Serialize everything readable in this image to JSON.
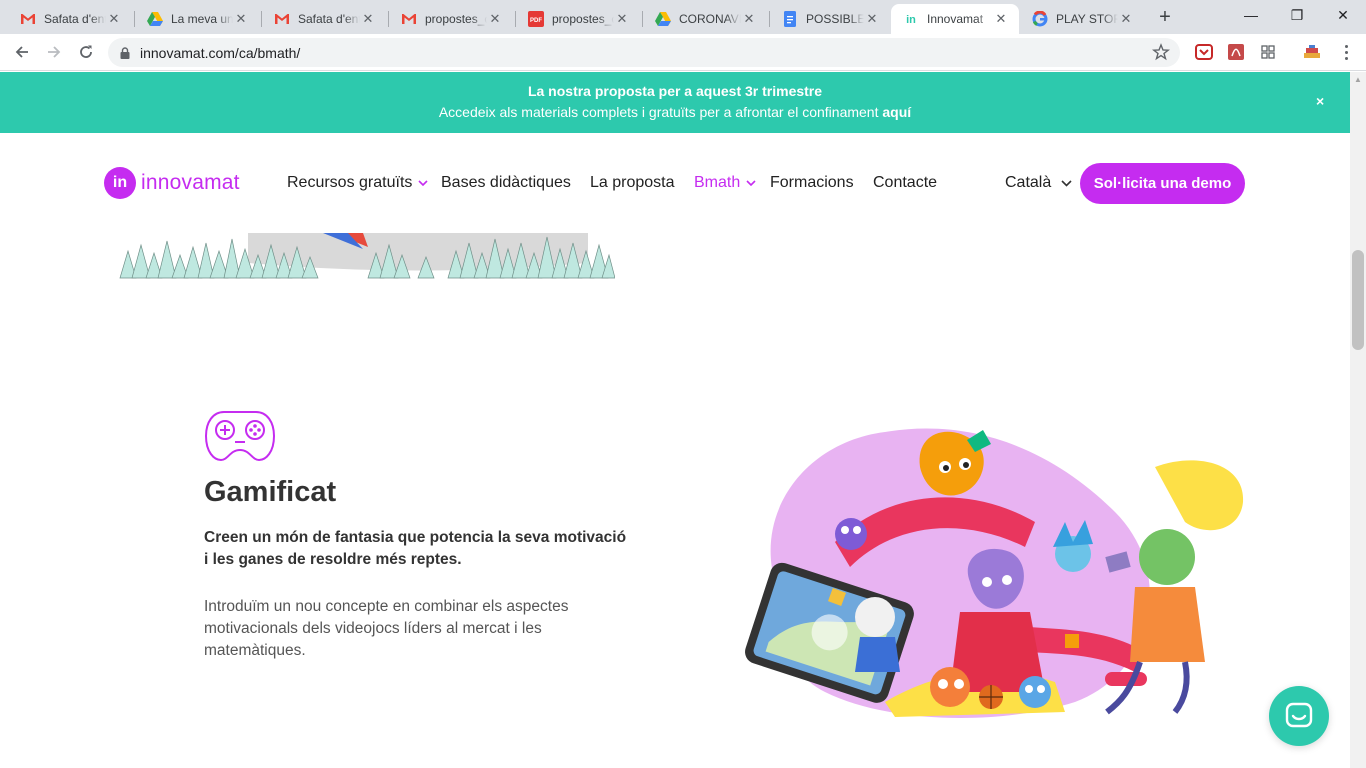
{
  "browser": {
    "tabs": [
      {
        "title": "Safata d'entrada",
        "icon": "gmail-icon"
      },
      {
        "title": "La meva unitat",
        "icon": "google-drive-icon"
      },
      {
        "title": "Safata d'entrada",
        "icon": "gmail-icon"
      },
      {
        "title": "propostes_cicle",
        "icon": "gmail-icon"
      },
      {
        "title": "propostes_cicle",
        "icon": "pdf-icon"
      },
      {
        "title": "CORONAVIRUS",
        "icon": "google-drive-icon"
      },
      {
        "title": "POSSIBLES",
        "icon": "google-docs-icon"
      },
      {
        "title": "Innovamat",
        "icon": "innovamat-icon",
        "active": true
      },
      {
        "title": "PLAY STORE",
        "icon": "google-icon"
      }
    ],
    "url": "innovamat.com/ca/bmath/",
    "window_controls": {
      "minimize": "—",
      "restore": "❐",
      "close": "✕"
    }
  },
  "banner": {
    "line1": "La nostra proposta per a aquest 3r trimestre",
    "line2": "Accedeix als materials complets i gratuïts per a afrontar el confinament",
    "link": "aquí",
    "close": "×"
  },
  "header": {
    "logo_mark": "in",
    "logo_text": "innovamat",
    "nav": {
      "recursos": "Recursos gratuïts",
      "bases": "Bases didàctiques",
      "proposta": "La proposta",
      "bmath": "Bmath",
      "formacions": "Formacions",
      "contacte": "Contacte"
    },
    "language": "Català",
    "cta": "Sol·licita una demo"
  },
  "feature": {
    "icon": "gamepad-icon",
    "title": "Gamificat",
    "lead": "Creen un món de fantasia que potencia la seva motivació i les ganes de resoldre més reptes.",
    "body": "Introduïm un nou concepte en combinar els aspectes motivacionals dels videojocs líders al mercat i les matemàtiques."
  },
  "colors": {
    "brand": "#c52cf0",
    "banner": "#2dc9ad",
    "text": "#333333"
  }
}
